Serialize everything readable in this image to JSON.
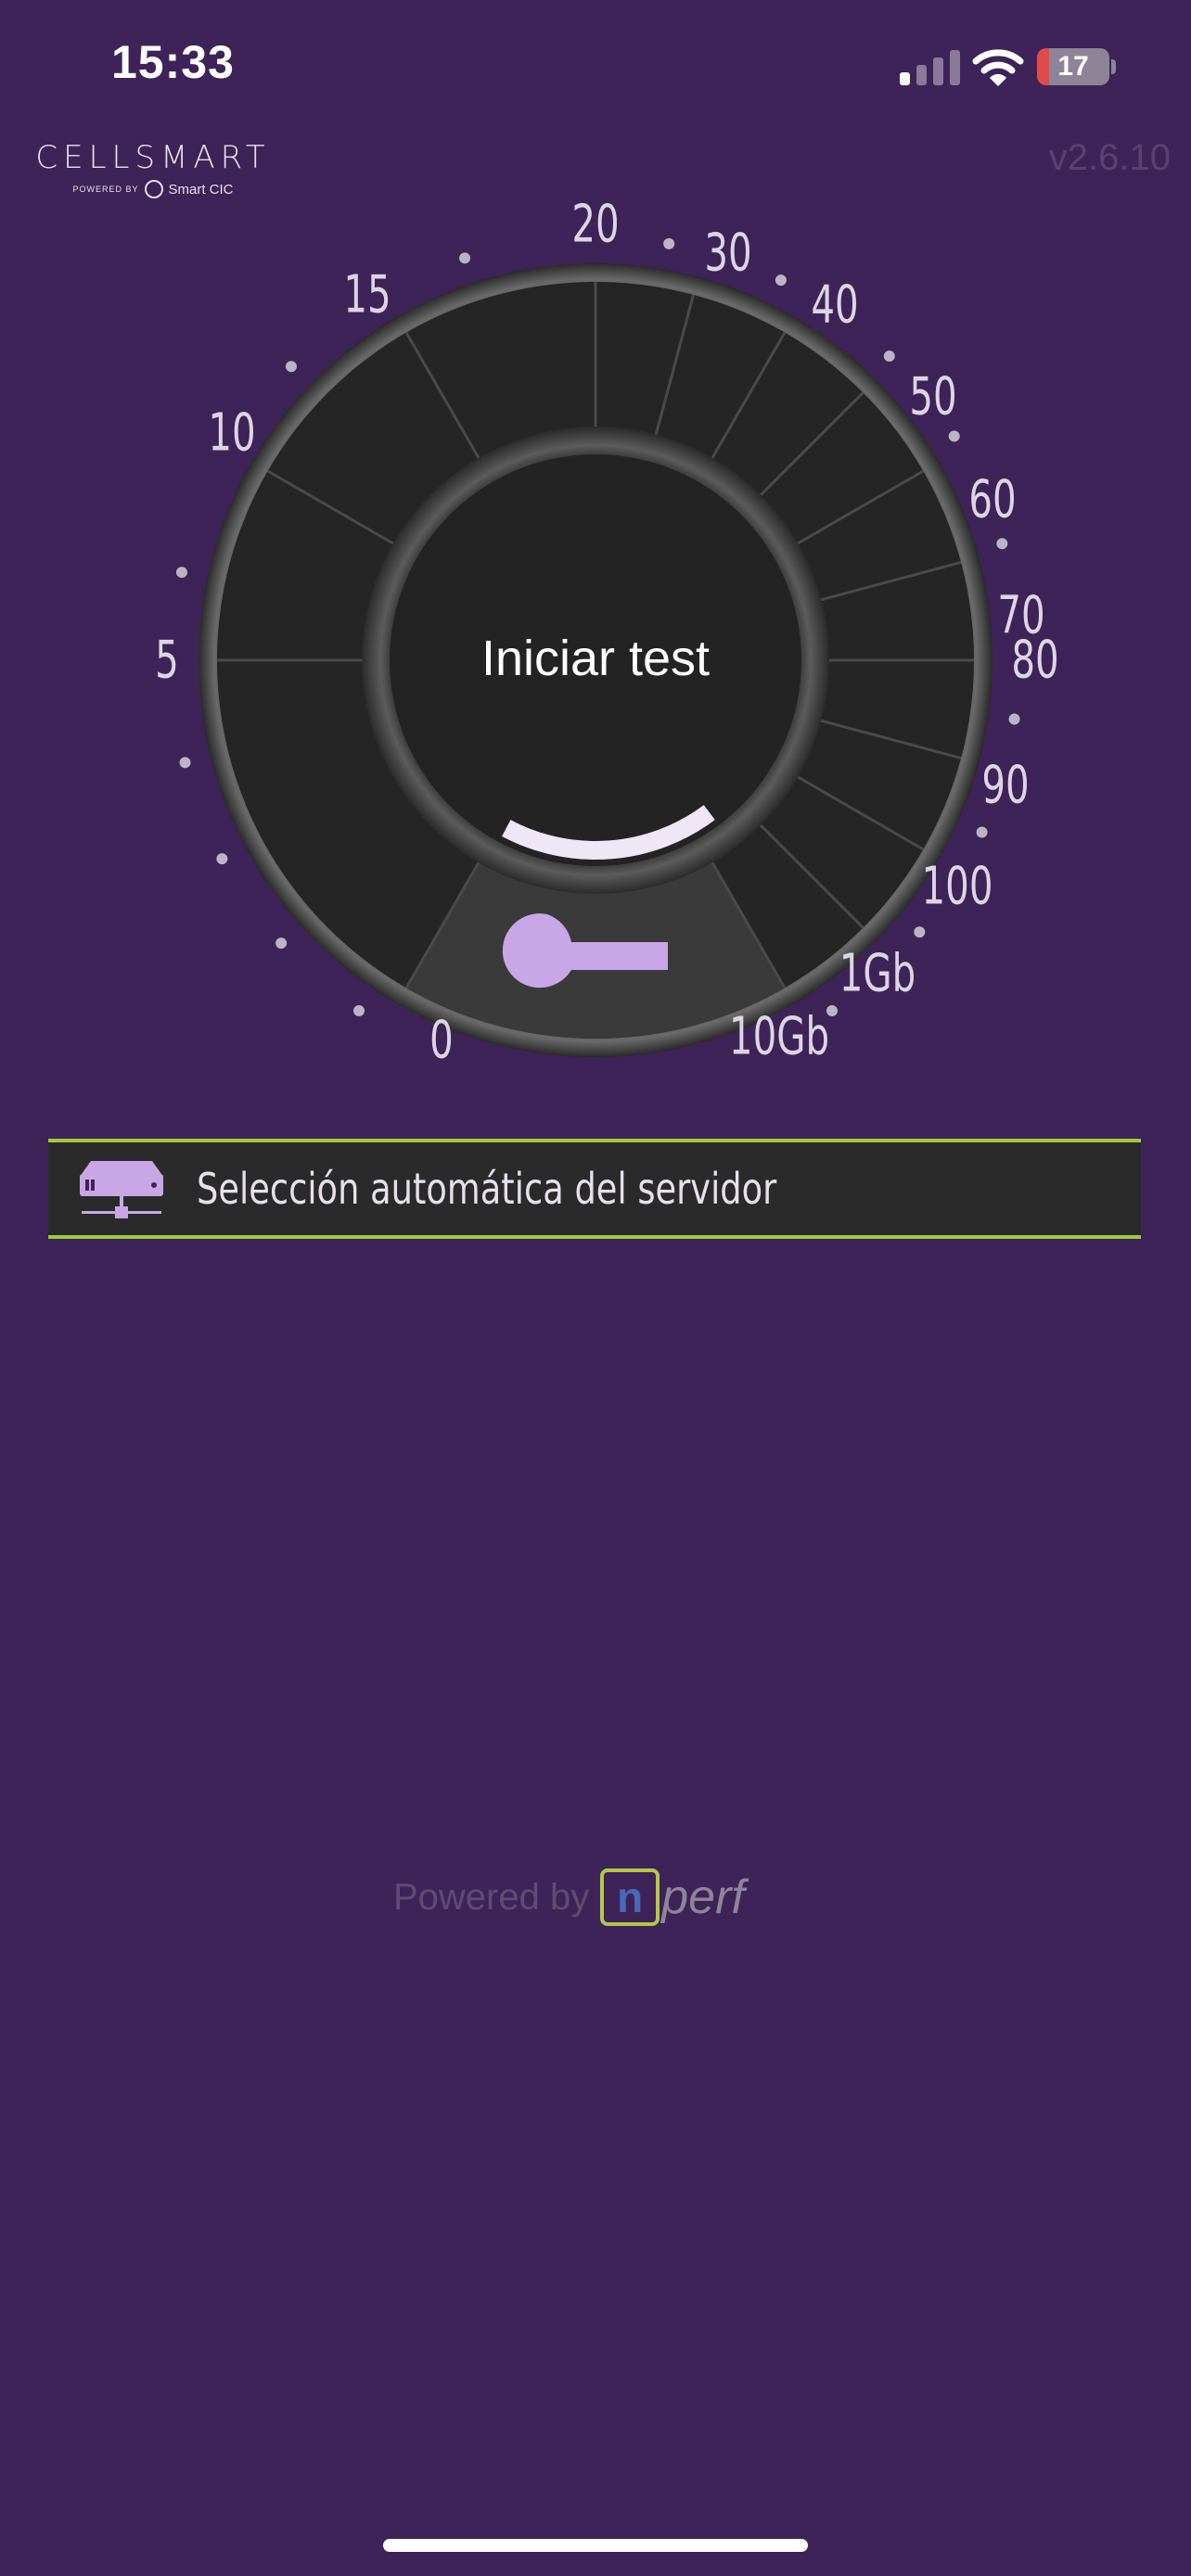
{
  "status_bar": {
    "time": "15:33",
    "battery_level": "17",
    "battery_fraction": 0.17,
    "signal_bars_active": 1,
    "signal_bars_total": 4
  },
  "header": {
    "brand_name": "CELLSMART",
    "brand_powered": "POWERED BY",
    "brand_partner": "Smart CIC",
    "version": "v2.6.10"
  },
  "gauge": {
    "scale_labels": [
      "0",
      "5",
      "10",
      "15",
      "20",
      "30",
      "40",
      "50",
      "60",
      "70",
      "80",
      "90",
      "100",
      "1Gb",
      "10Gb"
    ],
    "start_label": "Iniciar test",
    "settings_icon": "wrench-icon",
    "progress_fraction": 0.18
  },
  "server": {
    "icon": "server-icon",
    "label": "Selección automática del servidor"
  },
  "footer": {
    "powered_by": "Powered by",
    "logo_letter": "n",
    "logo_word": "perf"
  },
  "colors": {
    "background": "#3e2358",
    "accent": "#c9a6e6",
    "server_border": "#9dcc3c"
  }
}
